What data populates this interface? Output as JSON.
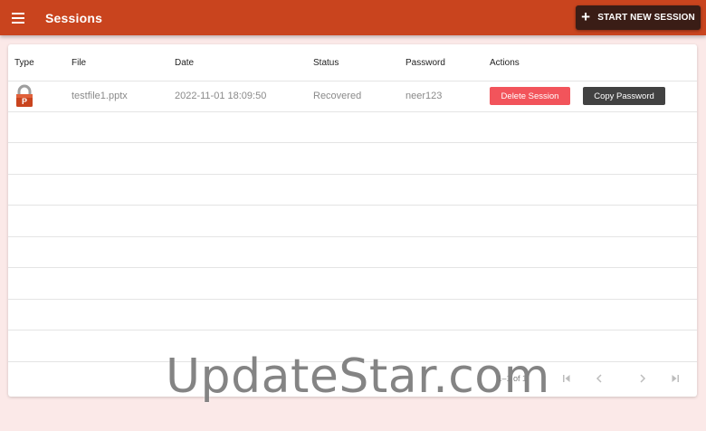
{
  "header": {
    "title": "Sessions",
    "start_button_label": "START NEW SESSION",
    "start_button_icon": "plus-icon",
    "menu_icon": "hamburger-menu-icon",
    "accent_color": "#c9441e"
  },
  "table": {
    "columns": [
      "Type",
      "File",
      "Date",
      "Status",
      "Password",
      "Actions"
    ],
    "rows": [
      {
        "type_icon": "locked-pptx-file-icon",
        "type_badge": "P",
        "file": "testfile1.pptx",
        "date": "2022-11-01 18:09:50",
        "status": "Recovered",
        "password": "neer123",
        "delete_label": "Delete Session",
        "copy_label": "Copy Password"
      }
    ]
  },
  "pagination": {
    "info": "1–1 of 1",
    "icons": [
      "first-page-icon",
      "prev-page-icon",
      "next-page-icon",
      "last-page-icon"
    ]
  },
  "watermark": {
    "text": "UpdateStar.com"
  }
}
